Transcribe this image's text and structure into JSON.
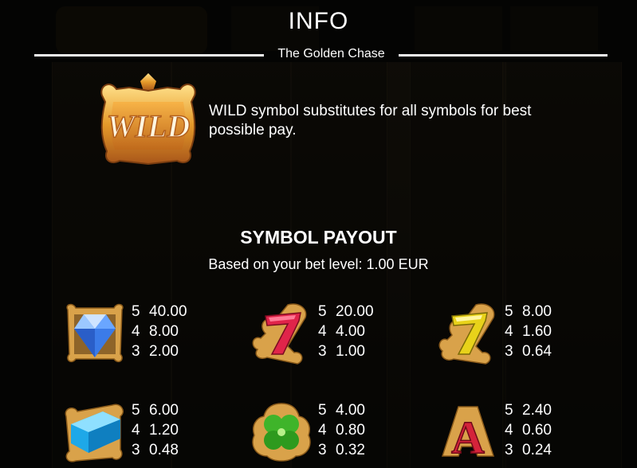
{
  "header": {
    "title": "INFO",
    "game_name": "The Golden Chase"
  },
  "wild": {
    "icon": "wild-crown-icon",
    "icon_label": "WILD",
    "description": "WILD symbol substitutes for all symbols for best possible pay."
  },
  "payout": {
    "title": "SYMBOL PAYOUT",
    "subtitle": "Based on your bet level: 1.00 EUR",
    "symbols": [
      {
        "icon": "blue-diamond-icon",
        "rows": [
          {
            "count": "5",
            "value": "40.00"
          },
          {
            "count": "4",
            "value": "8.00"
          },
          {
            "count": "3",
            "value": "2.00"
          }
        ]
      },
      {
        "icon": "red-seven-icon",
        "rows": [
          {
            "count": "5",
            "value": "20.00"
          },
          {
            "count": "4",
            "value": "4.00"
          },
          {
            "count": "3",
            "value": "1.00"
          }
        ]
      },
      {
        "icon": "yellow-seven-icon",
        "rows": [
          {
            "count": "5",
            "value": "8.00"
          },
          {
            "count": "4",
            "value": "1.60"
          },
          {
            "count": "3",
            "value": "0.64"
          }
        ]
      },
      {
        "icon": "blue-gem-bar-icon",
        "rows": [
          {
            "count": "5",
            "value": "6.00"
          },
          {
            "count": "4",
            "value": "1.20"
          },
          {
            "count": "3",
            "value": "0.48"
          }
        ]
      },
      {
        "icon": "clover-icon",
        "rows": [
          {
            "count": "5",
            "value": "4.00"
          },
          {
            "count": "4",
            "value": "0.80"
          },
          {
            "count": "3",
            "value": "0.32"
          }
        ]
      },
      {
        "icon": "letter-a-icon",
        "icon_label": "A",
        "rows": [
          {
            "count": "5",
            "value": "2.40"
          },
          {
            "count": "4",
            "value": "0.60"
          },
          {
            "count": "3",
            "value": "0.24"
          }
        ]
      }
    ]
  }
}
